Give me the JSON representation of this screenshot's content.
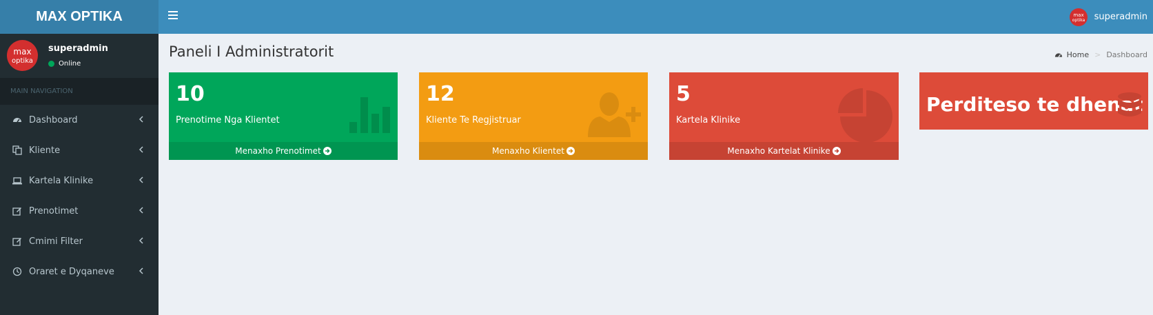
{
  "header": {
    "logo_text": "MAX OPTIKA",
    "user_name": "superadmin"
  },
  "sidebar": {
    "user": {
      "name": "superadmin",
      "status": "Online"
    },
    "nav_header": "MAIN NAVIGATION",
    "items": [
      {
        "label": "Dashboard",
        "icon": "dashboard-icon"
      },
      {
        "label": "Kliente",
        "icon": "copy-icon"
      },
      {
        "label": "Kartela Klinike",
        "icon": "laptop-icon"
      },
      {
        "label": "Prenotimet",
        "icon": "edit-icon"
      },
      {
        "label": "Cmimi Filter",
        "icon": "edit-icon"
      },
      {
        "label": "Oraret e Dyqaneve",
        "icon": "clock-icon"
      }
    ]
  },
  "main": {
    "title": "Paneli I Administratorit",
    "breadcrumb": {
      "home": "Home",
      "current": "Dashboard"
    }
  },
  "boxes": [
    {
      "number": "10",
      "label": "Prenotime Nga Klientet",
      "footer": "Menaxho Prenotimet",
      "icon": "bar-chart-icon"
    },
    {
      "number": "12",
      "label": "Kliente Te Regjistruar",
      "footer": "Menaxho Klientet",
      "icon": "user-plus-icon"
    },
    {
      "number": "5",
      "label": "Kartela Klinike",
      "footer": "Menaxho Kartelat Klinike",
      "icon": "pie-chart-icon"
    }
  ],
  "update_box": {
    "label": "Perditeso te dhenat",
    "icon": "database-icon"
  },
  "colors": {
    "topbar": "#3c8dbc",
    "sidebar": "#222d32",
    "green": "#00a65a",
    "orange": "#f39c12",
    "red": "#dd4b39"
  }
}
